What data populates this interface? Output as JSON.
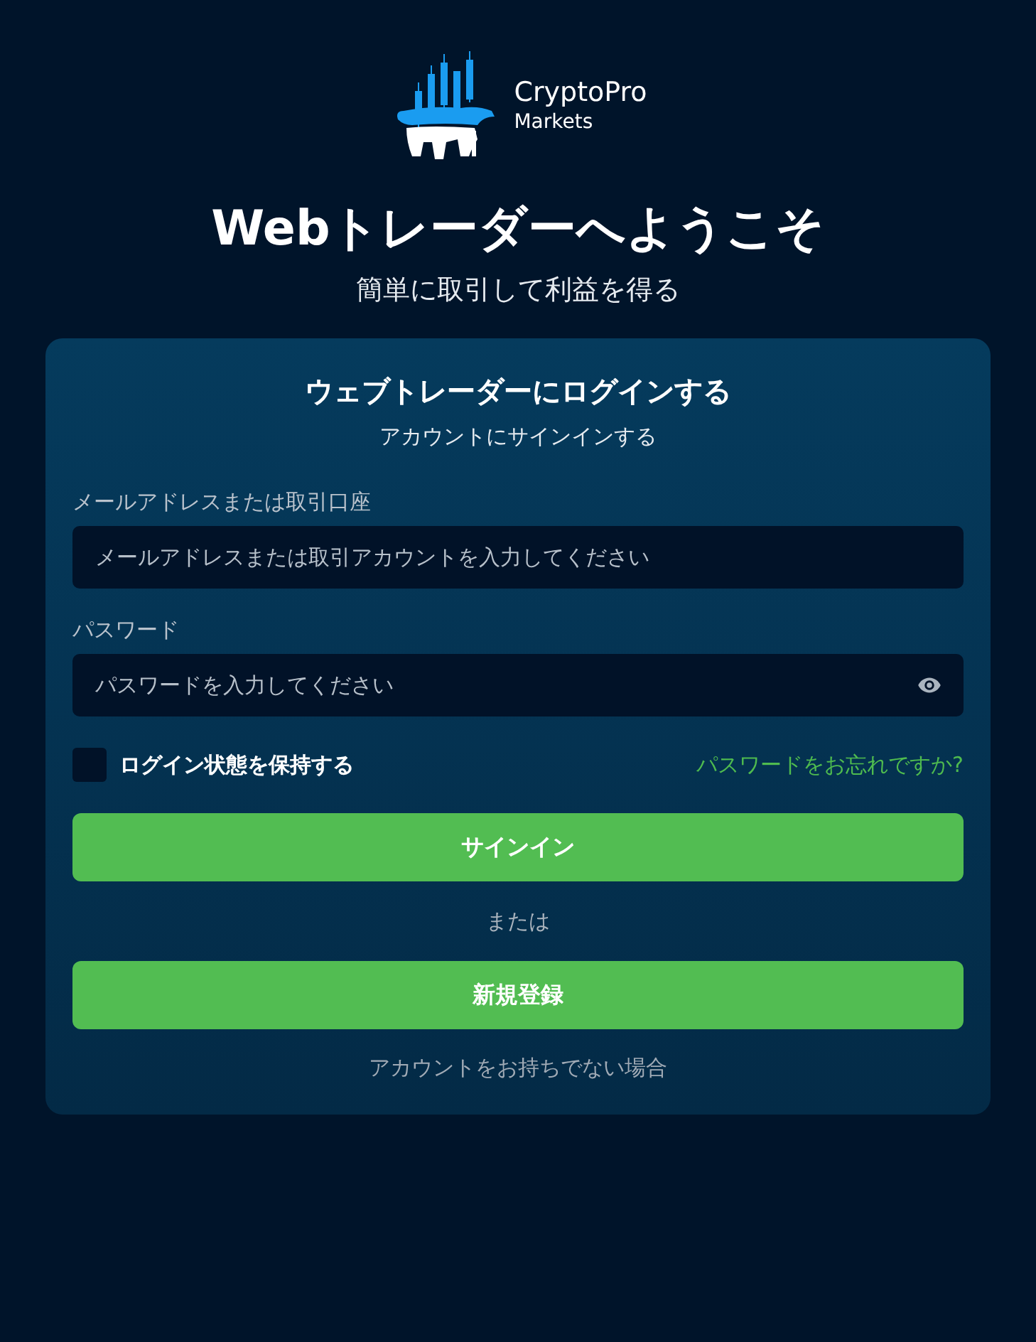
{
  "logo": {
    "name": "CryptoPro",
    "subtitle": "Markets"
  },
  "title": "Webトレーダーへようこそ",
  "subtitle": "簡単に取引して利益を得る",
  "card": {
    "title": "ウェブトレーダーにログインする",
    "subtitle": "アカウントにサインインする",
    "fields": [
      {
        "kind": "text",
        "label": "メールアドレスまたは取引口座",
        "placeholder": "メールアドレスまたは取引アカウントを入力してください"
      },
      {
        "kind": "password",
        "label": "パスワード",
        "placeholder": "パスワードを入力してください"
      }
    ],
    "remember": {
      "label": "ログイン状態を保持する",
      "checked": false
    },
    "forgot": "パスワードをお忘れですか?",
    "signin": "サインイン",
    "or": "または",
    "register": "新規登録",
    "note": "アカウントをお持ちでない場合"
  }
}
